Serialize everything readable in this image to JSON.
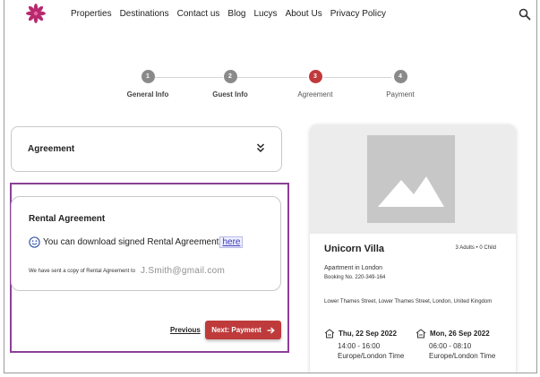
{
  "header": {
    "nav_items": [
      "Properties",
      "Destinations",
      "Contact us",
      "Blog",
      "Lucys",
      "About Us",
      "Privacy Policy"
    ]
  },
  "stepper": {
    "steps": [
      {
        "number": "1",
        "label": "General Info",
        "state": "done"
      },
      {
        "number": "2",
        "label": "Guest Info",
        "state": "done"
      },
      {
        "number": "3",
        "label": "Agreement",
        "state": "active"
      },
      {
        "number": "4",
        "label": "Payment",
        "state": "pending"
      }
    ]
  },
  "agreement_section": {
    "title": "Agreement"
  },
  "rental_agreement": {
    "title": "Rental Agreement",
    "download_text": "You can download signed Rental Agreement",
    "download_link": "here",
    "sent_text": "We have sent a copy of Rental Agreement to",
    "email": "J.Smith@gmail.com"
  },
  "actions": {
    "previous_label": "Previous",
    "next_label": "Next: Payment"
  },
  "property": {
    "name": "Unicorn Villa",
    "guests": "3 Adults • 0 Child",
    "type": "Apartment in London",
    "booking": "Booking No. 220-349-164",
    "address": "Lower Thames Street, Lower Thames Street, London, United Kingdom",
    "checkin": {
      "date": "Thu, 22 Sep 2022",
      "time": "14:00 - 16:00",
      "zone": "Europe/London Time"
    },
    "checkout": {
      "date": "Mon, 26 Sep 2022",
      "time": "06:00 - 08:10",
      "zone": "Europe/London Time"
    }
  },
  "colors": {
    "accent": "#bf3b3b",
    "highlight_border": "#8b3f97",
    "logo": "#b8296e"
  }
}
